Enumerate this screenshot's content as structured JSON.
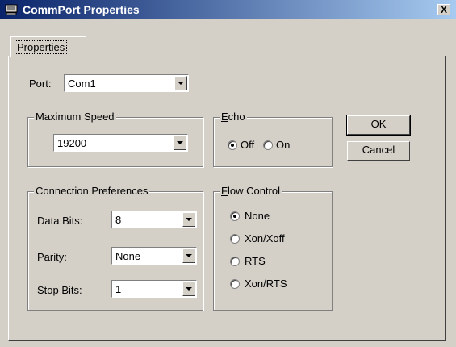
{
  "window": {
    "title": "CommPort Properties",
    "close_glyph": "X",
    "icon": "commport-icon"
  },
  "tabs": [
    {
      "label": "Properties",
      "selected": true
    }
  ],
  "port": {
    "label": "Port:",
    "value": "Com1"
  },
  "max_speed": {
    "legend": "Maximum Speed",
    "value": "19200"
  },
  "echo": {
    "legend_first": "E",
    "legend_rest": "cho",
    "options": [
      {
        "label": "Off",
        "selected": true
      },
      {
        "label": "On",
        "selected": false
      }
    ]
  },
  "buttons": {
    "ok": "OK",
    "cancel": "Cancel"
  },
  "connection": {
    "legend": "Connection Preferences",
    "data_bits": {
      "label": "Data Bits:",
      "value": "8"
    },
    "parity": {
      "label": "Parity:",
      "value": "None"
    },
    "stop_bits": {
      "label": "Stop Bits:",
      "value": "1"
    }
  },
  "flow_control": {
    "legend_first": "F",
    "legend_rest": "low Control",
    "options": [
      {
        "label": "None",
        "selected": true
      },
      {
        "label": "Xon/Xoff",
        "selected": false
      },
      {
        "label": "RTS",
        "selected": false
      },
      {
        "label": "Xon/RTS",
        "selected": false
      }
    ]
  }
}
